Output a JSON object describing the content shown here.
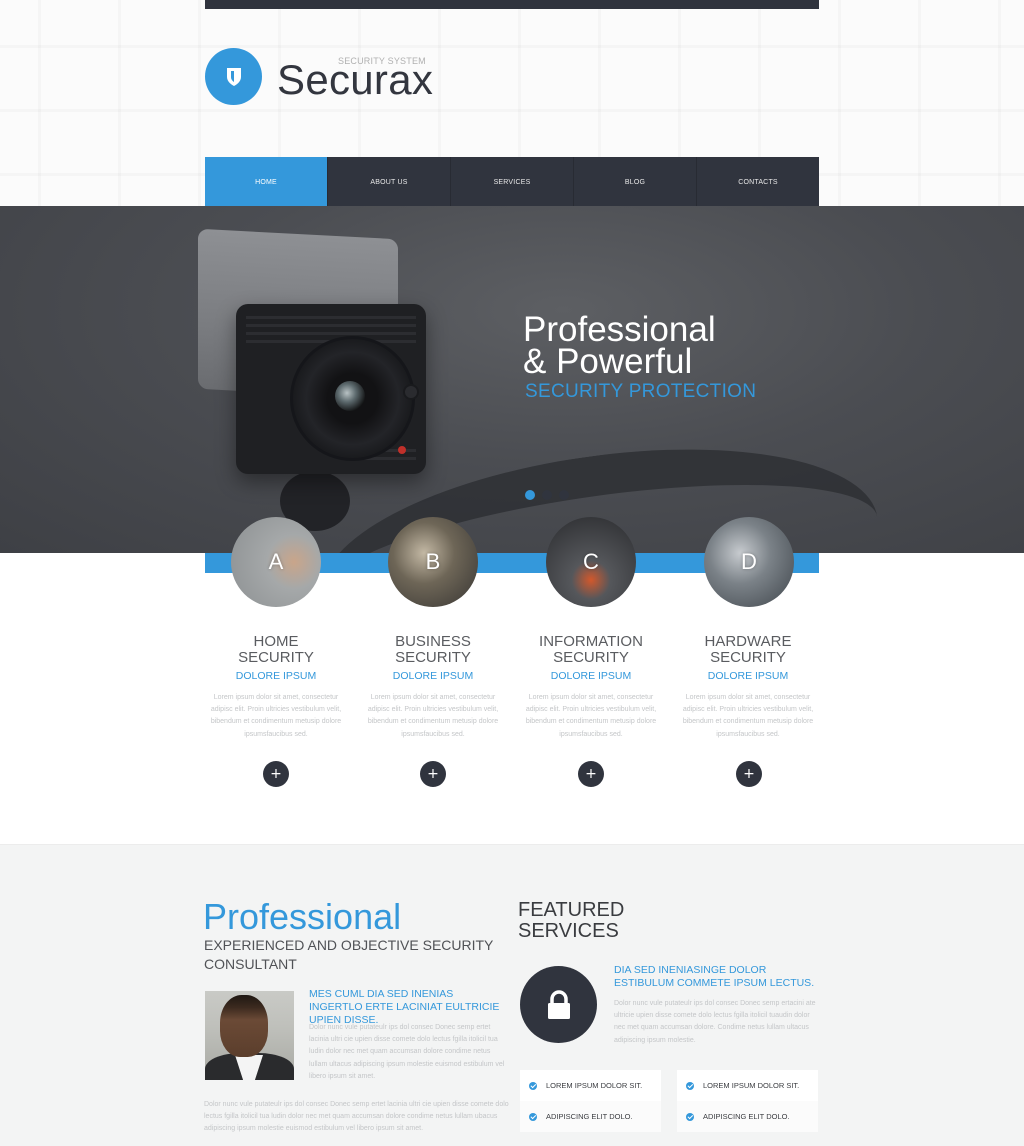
{
  "brand": {
    "name": "Securax",
    "tagline": "SECURITY SYSTEM",
    "logo_icon": "shield-icon",
    "accent_color": "#3498db",
    "dark_color": "#30343e"
  },
  "nav": {
    "items": [
      {
        "label": "HOME",
        "active": true
      },
      {
        "label": "ABOUT US",
        "active": false
      },
      {
        "label": "SERVICES",
        "active": false
      },
      {
        "label": "BLOG",
        "active": false
      },
      {
        "label": "CONTACTS",
        "active": false
      }
    ]
  },
  "hero": {
    "title_line1": "Professional",
    "title_line2": "& Powerful",
    "subtitle": "SECURITY PROTECTION",
    "slides_total": 3,
    "active_slide": 1
  },
  "features": [
    {
      "letter": "A",
      "title_line1": "HOME",
      "title_line2": "SECURITY",
      "subtitle": "DOLORE IPSUM",
      "text": "Lorem ipsum dolor sit amet, consectetur adipisc elit. Proin ultricies vestibulum velit, bibendum et condimentum metusip dolore ipsumsfaucibus sed.",
      "button_icon": "plus-icon"
    },
    {
      "letter": "B",
      "title_line1": "BUSINESS",
      "title_line2": "SECURITY",
      "subtitle": "DOLORE IPSUM",
      "text": "Lorem ipsum dolor sit amet, consectetur adipisc elit. Proin ultricies vestibulum velit, bibendum et condimentum metusip dolore ipsumsfaucibus sed.",
      "button_icon": "plus-icon"
    },
    {
      "letter": "C",
      "title_line1": "INFORMATION",
      "title_line2": "SECURITY",
      "subtitle": "DOLORE IPSUM",
      "text": "Lorem ipsum dolor sit amet, consectetur adipisc elit. Proin ultricies vestibulum velit, bibendum et condimentum metusip dolore ipsumsfaucibus sed.",
      "button_icon": "plus-icon"
    },
    {
      "letter": "D",
      "title_line1": "HARDWARE",
      "title_line2": "SECURITY",
      "subtitle": "DOLORE IPSUM",
      "text": "Lorem ipsum dolor sit amet, consectetur adipisc elit. Proin ultricies vestibulum velit, bibendum et condimentum metusip dolore ipsumsfaucibus sed.",
      "button_icon": "plus-icon"
    }
  ],
  "professional": {
    "title": "Professional",
    "subtitle": "EXPERIENCED AND OBJECTIVE SECURITY CONSULTANT",
    "heading": "MES CUML DIA SED INENIAS INGERTLO ERTE LACINIAT EULTRICIE UPIEN DISSE.",
    "text": "Dolor nunc vule putateulr ips dol consec Donec semp ertet lacinia ultri cie upien disse comete dolo lectus fgilla itolicil tua ludin dolor nec met quam accumsan dolore condime netus lullam ultacus adipiscing ipsum molestie euismod estibulum vel libero ipsum sit amet.",
    "text_wide": "Dolor nunc vule putateulr ips dol consec Donec semp ertet lacinia ultri cie upien disse comete dolo lectus fgilla itolicil tua ludin dolor nec met quam accumsan dolore condime netus lullam ubacus adipiscing ipsum molestie euismod estibulum vel libero ipsum sit amet."
  },
  "featured_services": {
    "title_line1": "FEATURED",
    "title_line2": "SERVICES",
    "icon": "lock-icon",
    "heading": "DIA SED INENIASINGE DOLOR ESTIBULUM COMMETE IPSUM LECTUS.",
    "text": "Dolor nunc vule putateulr ips dol consec Donec semp ertacini ate ultricie upien disse comete dolo lectus fgilla itolicil tuaudin dolor nec met quam accumsan dolore. Condime netus lullam ultacus adipiscing ipsum molestie.",
    "checklists": [
      [
        "LOREM IPSUM DOLOR SIT.",
        "ADIPISCING ELIT DOLO."
      ],
      [
        "LOREM IPSUM DOLOR SIT.",
        "ADIPISCING ELIT DOLO."
      ]
    ]
  }
}
